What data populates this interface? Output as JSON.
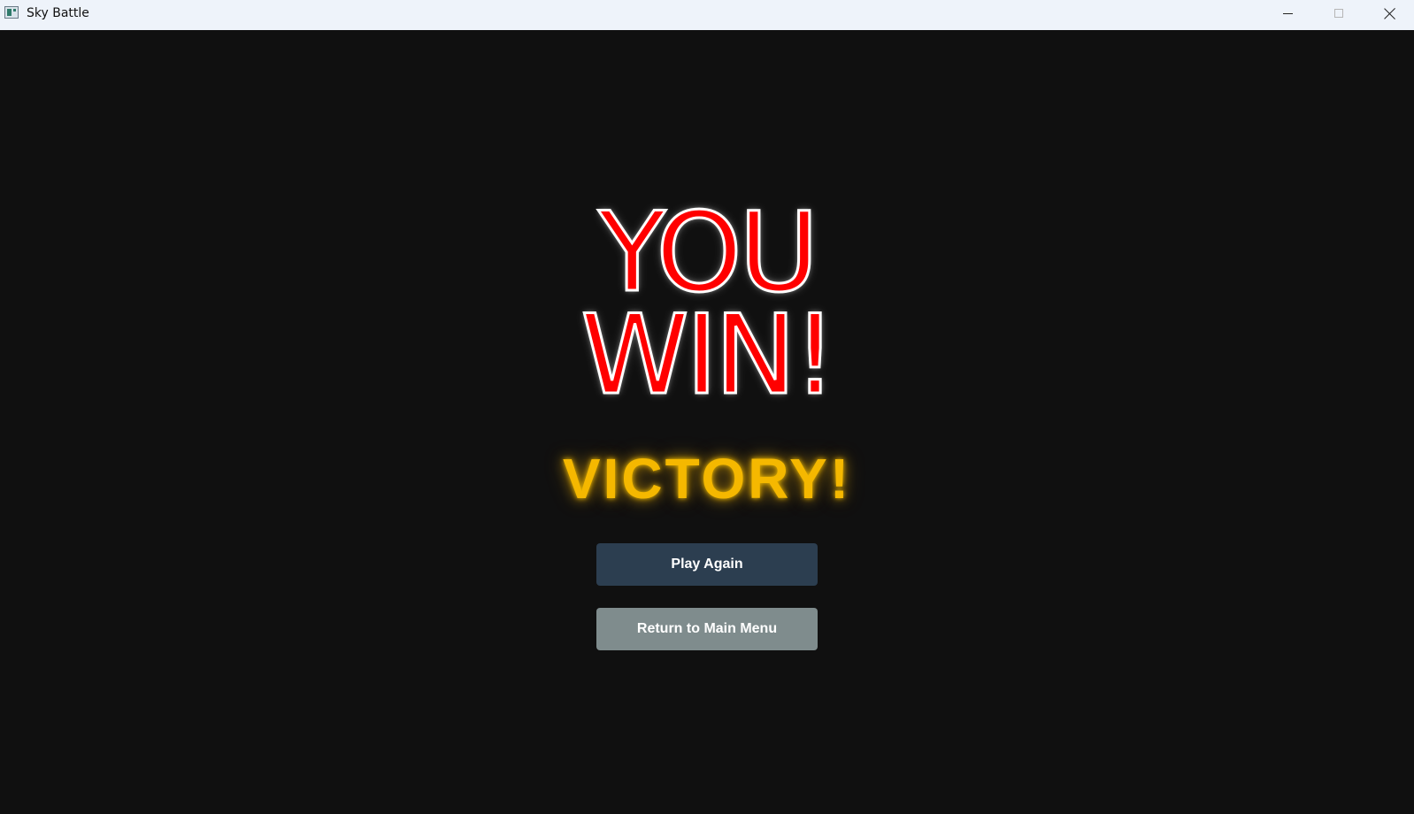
{
  "window": {
    "title": "Sky Battle",
    "icon": "app-window-icon",
    "controls": {
      "minimize_icon": "minimize-icon",
      "maximize_icon": "maximize-icon",
      "close_icon": "close-icon"
    }
  },
  "game_over": {
    "headline_line1": "YOU",
    "headline_line2": "WIN!",
    "subtitle": "VICTORY!",
    "buttons": {
      "play_again": "Play Again",
      "main_menu": "Return to Main Menu"
    }
  },
  "colors": {
    "background": "#101010",
    "headline_fill": "#ff0000",
    "headline_outline": "#ffffff",
    "subtitle": "#f5b800",
    "play_again_button": "#2c3e50",
    "main_menu_button": "#7f8c8d",
    "titlebar": "#eef3fa"
  }
}
